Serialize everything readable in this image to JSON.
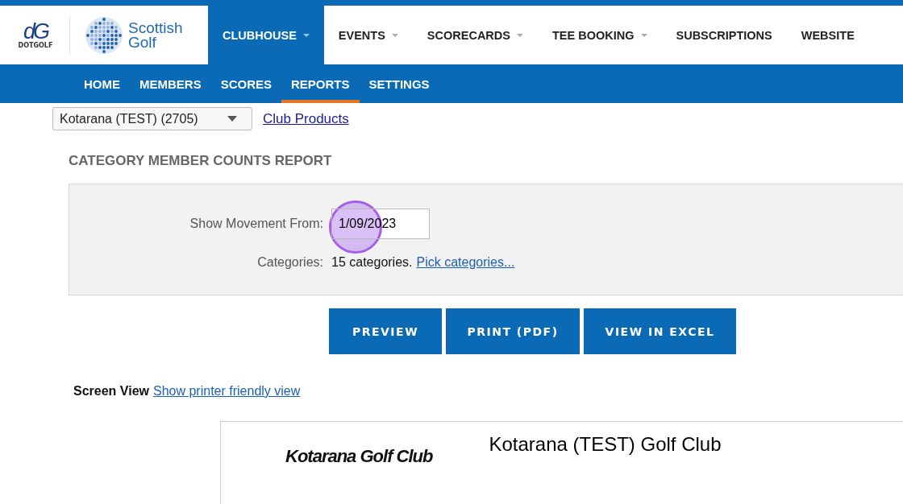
{
  "logos": {
    "dotgolf": {
      "mark": "dG",
      "label": "DOTGOLF"
    },
    "scottish_golf": {
      "line_1": "Scottish",
      "line_2": "Golf"
    }
  },
  "main_nav": [
    {
      "label": "CLUBHOUSE",
      "has_menu": true,
      "selected": true
    },
    {
      "label": "EVENTS",
      "has_menu": true,
      "selected": false
    },
    {
      "label": "SCORECARDS",
      "has_menu": true,
      "selected": false
    },
    {
      "label": "TEE BOOKING",
      "has_menu": true,
      "selected": false
    },
    {
      "label": "SUBSCRIPTIONS",
      "has_menu": false,
      "selected": false
    },
    {
      "label": "WEBSITE",
      "has_menu": false,
      "selected": false
    }
  ],
  "sub_nav": [
    {
      "label": "HOME",
      "selected": false
    },
    {
      "label": "MEMBERS",
      "selected": false
    },
    {
      "label": "SCORES",
      "selected": false
    },
    {
      "label": "REPORTS",
      "selected": true
    },
    {
      "label": "SETTINGS",
      "selected": false
    }
  ],
  "club_select": {
    "value": "Kotarana (TEST) (2705)"
  },
  "club_products_link": "Club Products",
  "report_title": "CATEGORY MEMBER COUNTS REPORT",
  "form": {
    "movement_label": "Show Movement From:",
    "movement_value": "1/09/2023",
    "click_indicator": true,
    "categories_label": "Categories:",
    "categories_value": "15 categories.",
    "categories_link": "Pick categories..."
  },
  "buttons": [
    "PREVIEW",
    "PRINT (PDF)",
    "VIEW IN EXCEL"
  ],
  "view": {
    "label": "Screen View",
    "link": "Show printer friendly view"
  },
  "report_preview": {
    "club_logo": "Kotarana Golf Club",
    "club_name": "Kotarana (TEST) Golf Club"
  }
}
